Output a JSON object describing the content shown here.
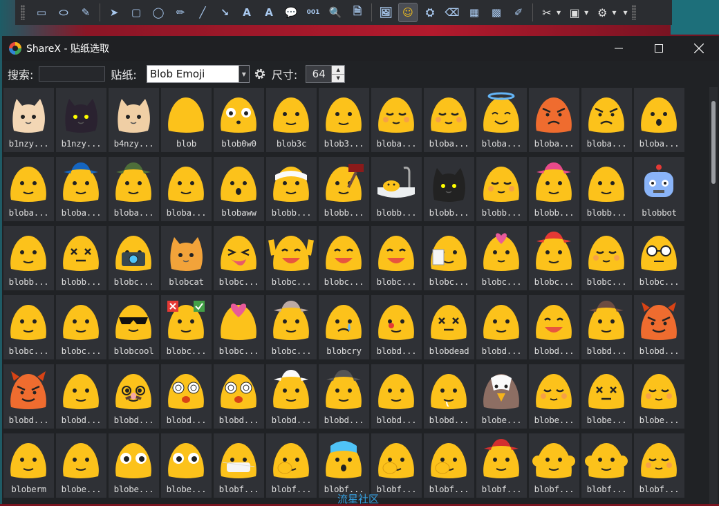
{
  "colors": {
    "blob_yellow": "#FCC21B",
    "window_bg": "#202225",
    "tile_bg": "#2f3136",
    "text": "#eaeaea"
  },
  "toolbar": {
    "tools": [
      {
        "name": "rectangle-region-icon",
        "glyph": "▭"
      },
      {
        "name": "ellipse-region-icon",
        "glyph": "⬭"
      },
      {
        "name": "freehand-region-icon",
        "glyph": "✎"
      },
      {
        "name": "select-arrow-icon",
        "glyph": "➤"
      },
      {
        "name": "rectangle-icon",
        "glyph": "▢"
      },
      {
        "name": "ellipse-icon",
        "glyph": "◯"
      },
      {
        "name": "freehand-icon",
        "glyph": "✏"
      },
      {
        "name": "line-icon",
        "glyph": "╱"
      },
      {
        "name": "arrow-icon",
        "glyph": "↘"
      },
      {
        "name": "text-icon",
        "glyph": "A"
      },
      {
        "name": "text-background-icon",
        "glyph": "A"
      },
      {
        "name": "speech-balloon-icon",
        "glyph": "💬"
      },
      {
        "name": "step-number-icon",
        "glyph": "001"
      },
      {
        "name": "magnify-icon",
        "glyph": "🔍"
      },
      {
        "name": "image-file-icon",
        "glyph": "🗎"
      },
      {
        "name": "image-screen-icon",
        "glyph": "🖼"
      },
      {
        "name": "sticker-icon",
        "glyph": "☺"
      },
      {
        "name": "cursor-icon",
        "glyph": "⛭"
      },
      {
        "name": "eraser-icon",
        "glyph": "⌫"
      },
      {
        "name": "blur-icon",
        "glyph": "▦"
      },
      {
        "name": "pixelate-icon",
        "glyph": "▩"
      },
      {
        "name": "highlight-icon",
        "glyph": "✐"
      }
    ]
  },
  "window": {
    "title": "ShareX - 贴纸选取",
    "search_label": "搜索:",
    "search_value": "",
    "sticker_label": "贴纸:",
    "sticker_pack": "Blob Emoji",
    "size_label": "尺寸:",
    "size_value": "64"
  },
  "stickers": [
    {
      "label": "b1nzy...",
      "kind": "cat",
      "color": "#f3d7b5",
      "face": "cat"
    },
    {
      "label": "b1nzy...",
      "kind": "cat",
      "color": "#2a2230",
      "face": "cat"
    },
    {
      "label": "b4nzy...",
      "kind": "cat",
      "color": "#f0cfa5",
      "face": "cat"
    },
    {
      "label": "blob",
      "kind": "blob",
      "face": "none"
    },
    {
      "label": "blob0w0",
      "kind": "blob",
      "face": "owo"
    },
    {
      "label": "blob3c",
      "kind": "blob",
      "face": "smug"
    },
    {
      "label": "blob3...",
      "kind": "blob",
      "face": "smug"
    },
    {
      "label": "bloba...",
      "kind": "blob",
      "face": "sleepy"
    },
    {
      "label": "bloba...",
      "kind": "blob",
      "face": "content"
    },
    {
      "label": "bloba...",
      "kind": "blob",
      "face": "halo"
    },
    {
      "label": "bloba...",
      "kind": "angry",
      "face": "angry"
    },
    {
      "label": "bloba...",
      "kind": "blob",
      "face": "annoyed"
    },
    {
      "label": "bloba...",
      "kind": "blob",
      "face": "surprised"
    },
    {
      "label": "bloba...",
      "kind": "blob",
      "face": "frown"
    },
    {
      "label": "bloba...",
      "kind": "blob",
      "face": "artist"
    },
    {
      "label": "bloba...",
      "kind": "blob",
      "face": "aviator"
    },
    {
      "label": "bloba...",
      "kind": "blob",
      "face": "meh"
    },
    {
      "label": "blobaww",
      "kind": "blob",
      "face": "aww"
    },
    {
      "label": "blobb...",
      "kind": "blob",
      "face": "bandage"
    },
    {
      "label": "blobb...",
      "kind": "blob",
      "face": "banhammer"
    },
    {
      "label": "blobb...",
      "kind": "bath",
      "face": "bath"
    },
    {
      "label": "blobb...",
      "kind": "cat",
      "color": "#222",
      "face": "cat"
    },
    {
      "label": "blobb...",
      "kind": "blob",
      "face": "blush"
    },
    {
      "label": "blobb...",
      "kind": "blob",
      "face": "bike"
    },
    {
      "label": "blobb...",
      "kind": "blob",
      "face": "neutral"
    },
    {
      "label": "blobbot",
      "kind": "bot",
      "face": "bot"
    },
    {
      "label": "blobb...",
      "kind": "blob",
      "face": "bow"
    },
    {
      "label": "blobb...",
      "kind": "blob",
      "face": "broken"
    },
    {
      "label": "blobc...",
      "kind": "blob",
      "face": "camera"
    },
    {
      "label": "blobcat",
      "kind": "cat",
      "color": "#f2a33a",
      "face": "cat"
    },
    {
      "label": "blobc...",
      "kind": "blob",
      "face": "tongue"
    },
    {
      "label": "blobc...",
      "kind": "blob",
      "face": "cheer"
    },
    {
      "label": "blobc...",
      "kind": "blob",
      "face": "grin"
    },
    {
      "label": "blobc...",
      "kind": "blob",
      "face": "grin"
    },
    {
      "label": "blobc...",
      "kind": "blob",
      "face": "clipboard"
    },
    {
      "label": "blobc...",
      "kind": "blob",
      "face": "hearts"
    },
    {
      "label": "blobc...",
      "kind": "blob",
      "face": "coffee"
    },
    {
      "label": "blobc...",
      "kind": "blob",
      "face": "sleepy"
    },
    {
      "label": "blobc...",
      "kind": "blob",
      "face": "nerd"
    },
    {
      "label": "blobc...",
      "kind": "blob",
      "face": "frown"
    },
    {
      "label": "blobc...",
      "kind": "blob",
      "face": "confused"
    },
    {
      "label": "blobcool",
      "kind": "blob",
      "face": "cool"
    },
    {
      "label": "blobc...",
      "kind": "blob",
      "face": "signs"
    },
    {
      "label": "blobc...",
      "kind": "blob",
      "face": "couple"
    },
    {
      "label": "blobc...",
      "kind": "blob",
      "face": "cowboy"
    },
    {
      "label": "blobcry",
      "kind": "blob",
      "face": "cry"
    },
    {
      "label": "blobd...",
      "kind": "blob",
      "face": "dance"
    },
    {
      "label": "blobdead",
      "kind": "blob",
      "face": "dead"
    },
    {
      "label": "blobd...",
      "kind": "blob",
      "face": "wink"
    },
    {
      "label": "blobd...",
      "kind": "blob",
      "face": "grin"
    },
    {
      "label": "blobd...",
      "kind": "blob",
      "face": "detective"
    },
    {
      "label": "blobd...",
      "kind": "angry",
      "face": "devil"
    },
    {
      "label": "blobd...",
      "kind": "angry",
      "face": "devil"
    },
    {
      "label": "blobd...",
      "kind": "blob",
      "face": "wide"
    },
    {
      "label": "blobd...",
      "kind": "blob",
      "face": "disguise"
    },
    {
      "label": "blobd...",
      "kind": "blob",
      "face": "dizzy"
    },
    {
      "label": "blobd...",
      "kind": "blob",
      "face": "dizzy"
    },
    {
      "label": "blobd...",
      "kind": "blob",
      "face": "doctor"
    },
    {
      "label": "blobd...",
      "kind": "blob",
      "face": "hat"
    },
    {
      "label": "blobd...",
      "kind": "blob",
      "face": "meh"
    },
    {
      "label": "blobd...",
      "kind": "blob",
      "face": "drool"
    },
    {
      "label": "blobe...",
      "kind": "eagle",
      "face": "eagle"
    },
    {
      "label": "blobe...",
      "kind": "blob",
      "face": "blush"
    },
    {
      "label": "blobe...",
      "kind": "blob",
      "face": "xd"
    },
    {
      "label": "blobe...",
      "kind": "blob",
      "face": "content"
    },
    {
      "label": "bloberm",
      "kind": "blob",
      "face": "neutral"
    },
    {
      "label": "blobe...",
      "kind": "blob",
      "face": "expressionless"
    },
    {
      "label": "blobe...",
      "kind": "blob",
      "face": "eyes"
    },
    {
      "label": "blobe...",
      "kind": "blob",
      "face": "eyes"
    },
    {
      "label": "blobf...",
      "kind": "blob",
      "face": "mask"
    },
    {
      "label": "blobf...",
      "kind": "blob",
      "face": "facepalm"
    },
    {
      "label": "blobf...",
      "kind": "blob",
      "face": "fear"
    },
    {
      "label": "blobf...",
      "kind": "blob",
      "face": "finger"
    },
    {
      "label": "blobf...",
      "kind": "blob",
      "face": "fingers"
    },
    {
      "label": "blobf...",
      "kind": "blob",
      "face": "fire"
    },
    {
      "label": "blobf...",
      "kind": "blob",
      "face": "flex"
    },
    {
      "label": "blobf...",
      "kind": "blob",
      "face": "flex"
    },
    {
      "label": "blobf...",
      "kind": "blob",
      "face": "content"
    }
  ],
  "watermark": "流星社区"
}
